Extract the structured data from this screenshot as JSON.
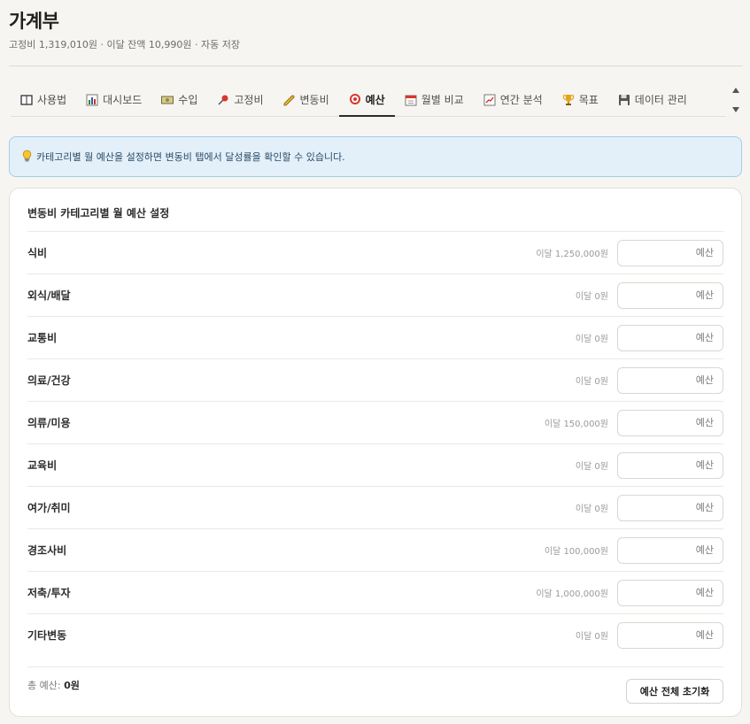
{
  "header": {
    "title": "가계부",
    "subtitle": "고정비 1,319,010원 · 이달 잔액 10,990원 · 자동 저장"
  },
  "tabs": [
    {
      "label": "사용법",
      "icon": "book-icon"
    },
    {
      "label": "대시보드",
      "icon": "bar-chart-icon"
    },
    {
      "label": "수입",
      "icon": "money-icon"
    },
    {
      "label": "고정비",
      "icon": "pushpin-icon"
    },
    {
      "label": "변동비",
      "icon": "pencil-icon"
    },
    {
      "label": "예산",
      "icon": "target-icon",
      "active": true
    },
    {
      "label": "월별 비교",
      "icon": "calendar-icon"
    },
    {
      "label": "연간 분석",
      "icon": "line-chart-icon"
    },
    {
      "label": "목표",
      "icon": "trophy-icon"
    },
    {
      "label": "데이터 관리",
      "icon": "floppy-disk-icon"
    }
  ],
  "info_banner": {
    "icon": "lightbulb-icon",
    "text": "카테고리별 월 예산을 설정하면 변동비 탭에서 달성률을 확인할 수 있습니다."
  },
  "budget_card": {
    "title": "변동비 카테고리별 월 예산 설정",
    "input_placeholder": "예산",
    "rows": [
      {
        "category": "식비",
        "spent": "이달 1,250,000원"
      },
      {
        "category": "외식/배달",
        "spent": "이달 0원"
      },
      {
        "category": "교통비",
        "spent": "이달 0원"
      },
      {
        "category": "의료/건강",
        "spent": "이달 0원"
      },
      {
        "category": "의류/미용",
        "spent": "이달 150,000원"
      },
      {
        "category": "교육비",
        "spent": "이달 0원"
      },
      {
        "category": "여가/취미",
        "spent": "이달 0원"
      },
      {
        "category": "경조사비",
        "spent": "이달 100,000원"
      },
      {
        "category": "저축/투자",
        "spent": "이달 1,000,000원"
      },
      {
        "category": "기타변동",
        "spent": "이달 0원"
      }
    ],
    "total_label": "총 예산:",
    "total_value": "0원",
    "reset_label": "예산 전체 초기화"
  }
}
